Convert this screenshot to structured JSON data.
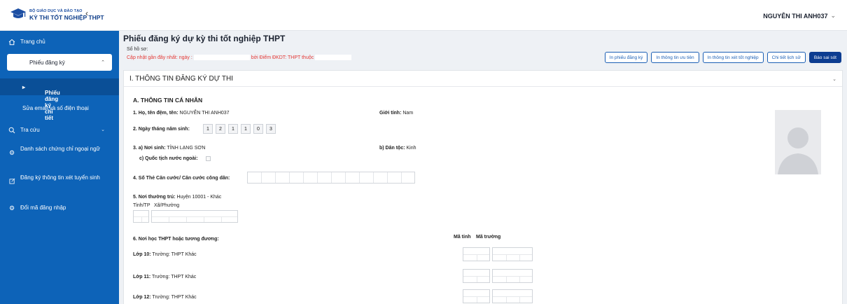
{
  "header": {
    "logo_line1": "BỘ GIÁO DỤC VÀ ĐÀO TẠO",
    "logo_line2": "KỲ THI TỐT NGHIỆP THPT",
    "user_name": "NGUYỄN THI ANH037"
  },
  "sidebar": {
    "items": [
      {
        "label": "Trang chủ",
        "icon": "home-icon"
      },
      {
        "label": "Phiếu đăng ký"
      },
      {
        "label": "Phiếu đăng ký chi tiết"
      },
      {
        "label": "Sửa email và số điện thoại"
      },
      {
        "label": "Tra cứu",
        "icon": "search-icon"
      },
      {
        "label": "Danh sách chứng chỉ ngoại ngữ",
        "icon": "settings-icon"
      },
      {
        "label": "Đăng ký thông tin xét tuyển sinh",
        "icon": "edit-icon"
      },
      {
        "label": "Đổi mã đăng nhập",
        "icon": "settings-icon"
      }
    ]
  },
  "page": {
    "title": "Phiếu đăng ký dự kỳ thi tốt nghiệp THPT",
    "ho_so_label": "Số hồ sơ:",
    "updated_prefix": "Cập nhật gần đây nhất: ngày :",
    "updated_mid": "bởi Điểm ĐKDT: THPT thuộc"
  },
  "actions": [
    "In phiếu đăng ký",
    "In thông tin ưu tiên",
    "In thông tin xét tốt nghiệp",
    "Chi tiết lịch sử",
    "Báo sai sót"
  ],
  "section": {
    "title": "I. THÔNG TIN ĐĂNG KÝ DỰ THI",
    "subtitle": "A. THÔNG TIN CÁ NHÂN",
    "name_label": "1. Họ, tên đệm, tên:",
    "name_value": "NGUYỄN THI ANH037",
    "gender_label": "Giới tính:",
    "gender_value": "Nam",
    "dob_label": "2. Ngày tháng năm sinh:",
    "dob_digits": [
      "1",
      "2",
      "1",
      "1",
      "0",
      "3"
    ],
    "birthplace_label": "3. a) Nơi sinh:",
    "birthplace_value": "TỈNH LẠNG SƠN",
    "ethnic_label": "b) Dân tộc:",
    "ethnic_value": "Kinh",
    "foreign_label": "c) Quốc tịch nước ngoài:",
    "id_label": "4. Số Thẻ Căn cước/ Căn cước công dân:",
    "residence_label": "5. Nơi thường trú:",
    "residence_value": "Huyện 10001 - Khác",
    "province_label": "Tỉnh/TP",
    "ward_label": "Xã/Phường",
    "school_label": "6. Nơi học THPT hoặc tương đương:",
    "col_ma_tinh": "Mã tỉnh",
    "col_ma_truong": "Mã trường",
    "grades": [
      {
        "label": "Lớp 10:",
        "value": "Trường: THPT Khác"
      },
      {
        "label": "Lớp 11:",
        "value": "Trường: THPT Khác"
      },
      {
        "label": "Lớp 12:",
        "value": "Trường: THPT Khác"
      }
    ]
  }
}
